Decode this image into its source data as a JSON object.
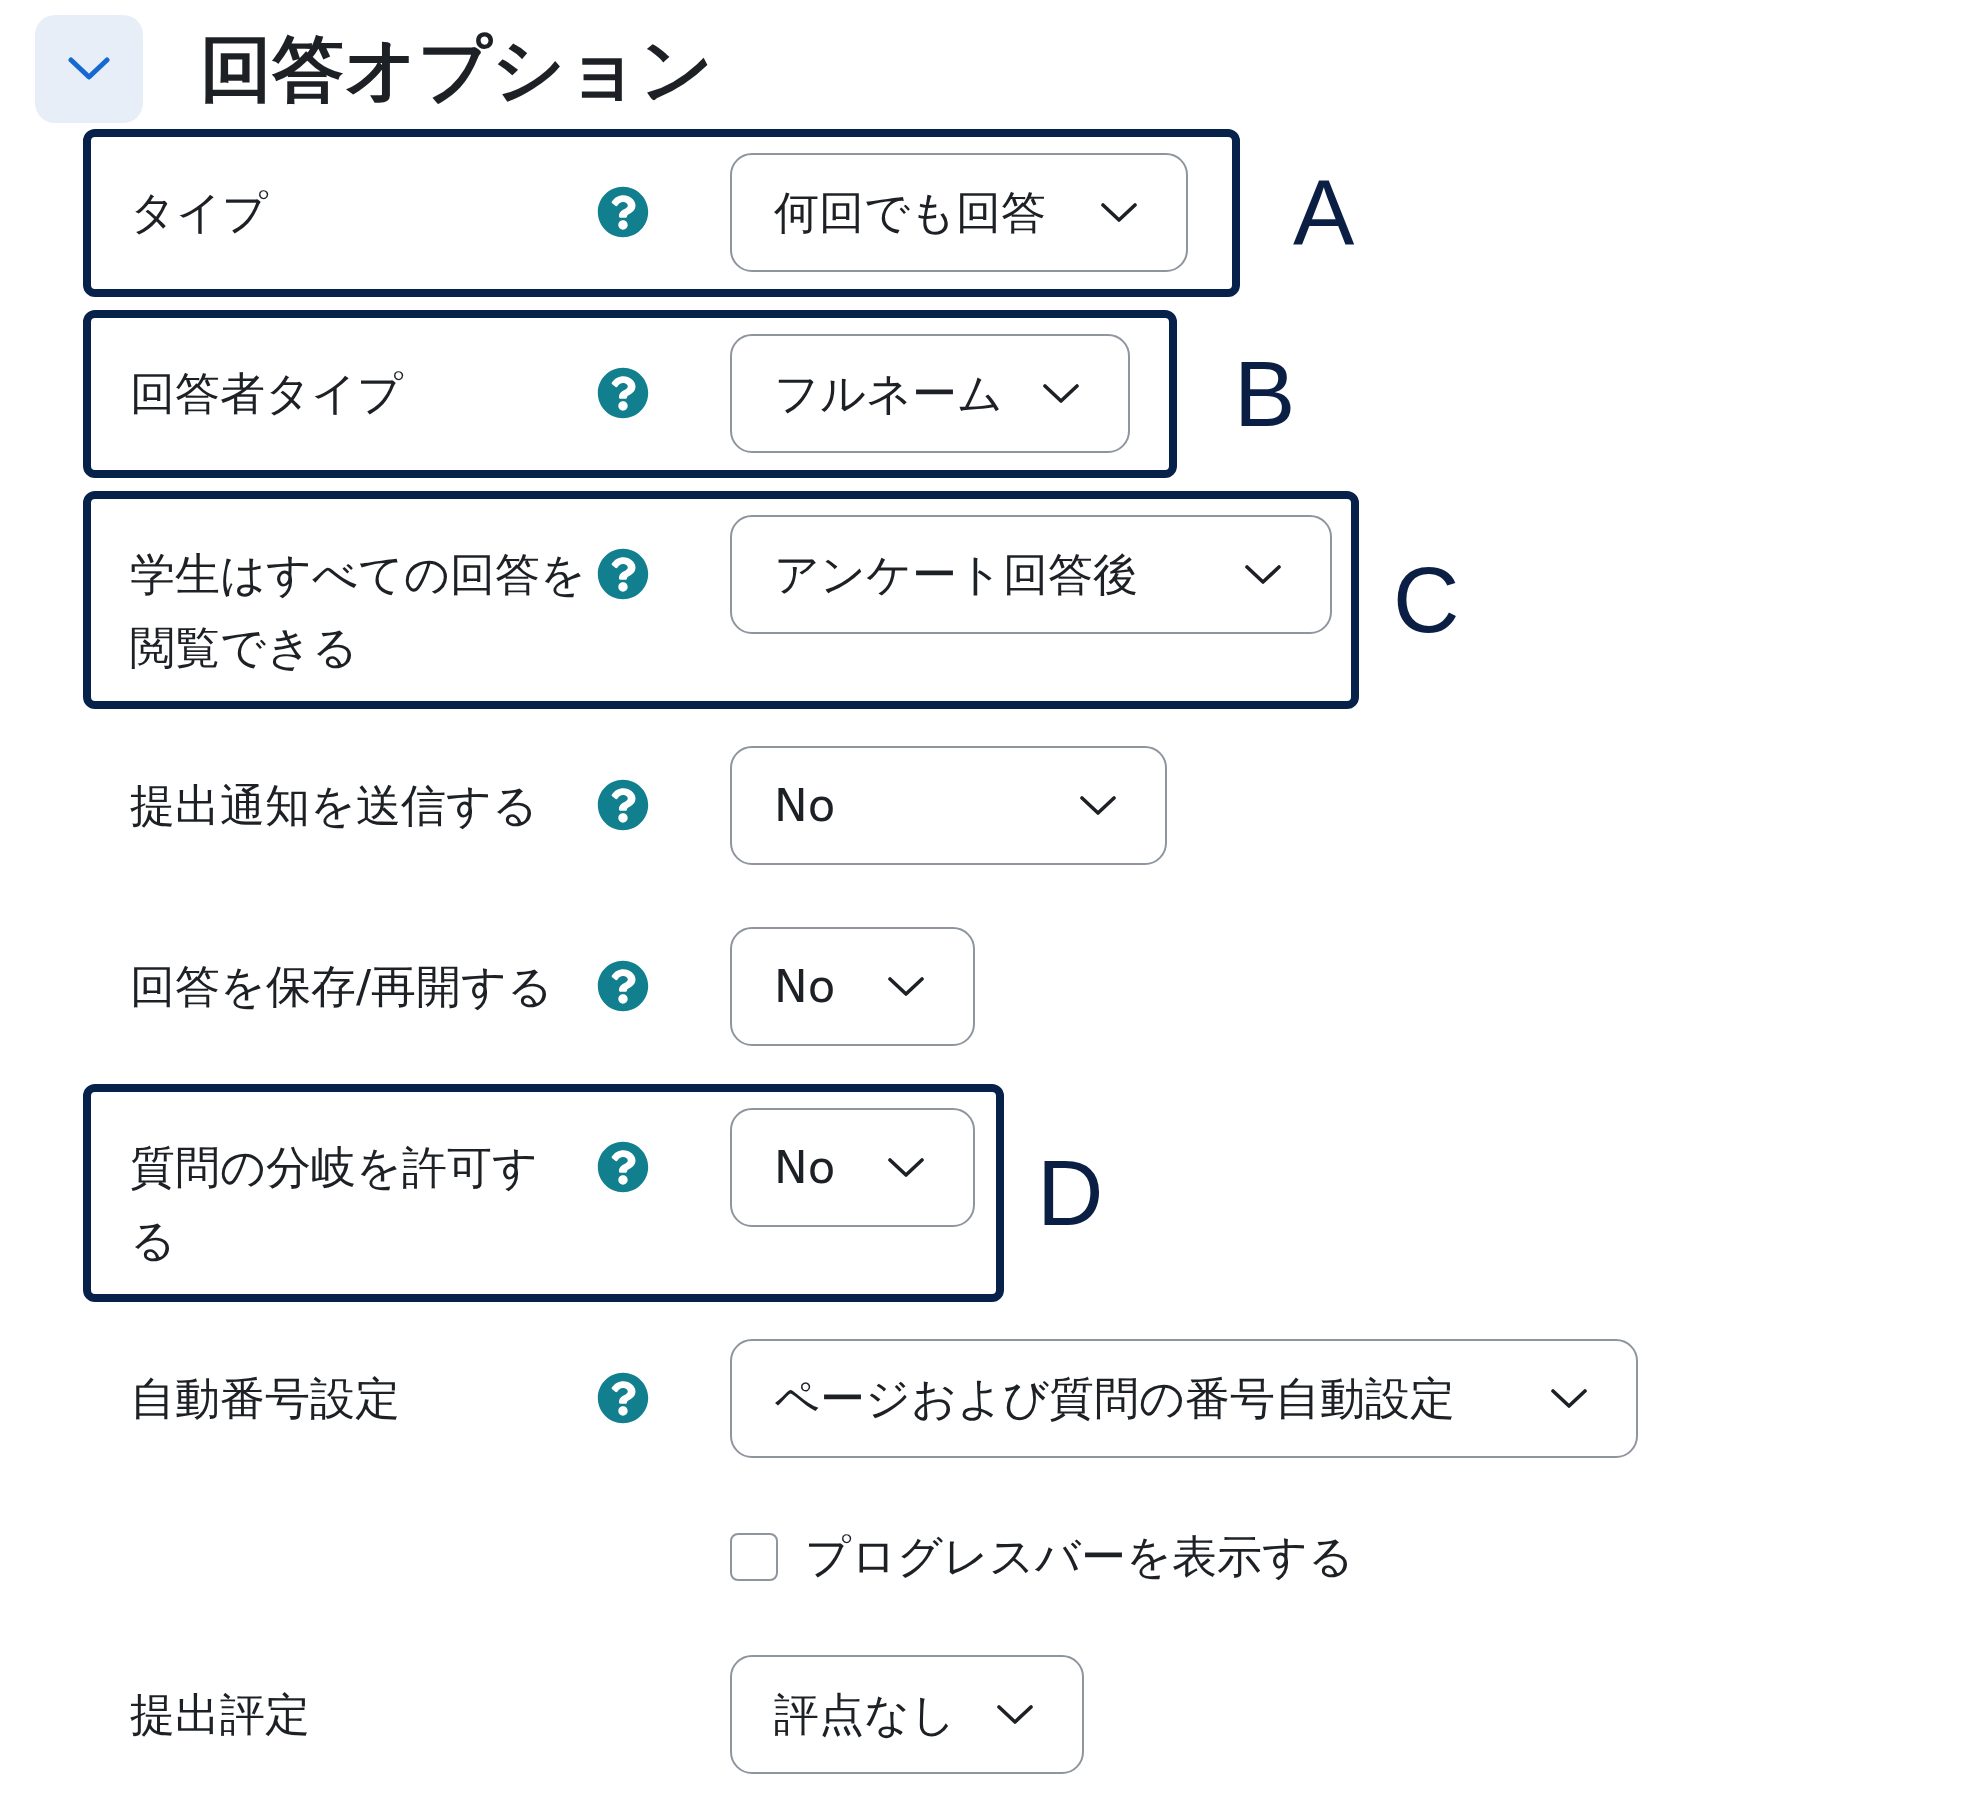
{
  "section": {
    "title": "回答オプション",
    "expanded": true
  },
  "fields": [
    {
      "kind": "select",
      "label": "タイプ",
      "help": true,
      "value": "何回でも回答",
      "callout": "A"
    },
    {
      "kind": "select",
      "label": "回答者タイプ",
      "help": true,
      "value": "フルネーム",
      "callout": "B"
    },
    {
      "kind": "select",
      "label": "学生はすべての回答を閲覧できる",
      "help": true,
      "value": "アンケート回答後",
      "callout": "C"
    },
    {
      "kind": "select",
      "label": "提出通知を送信する",
      "help": true,
      "value": "No"
    },
    {
      "kind": "select",
      "label": "回答を保存/再開する",
      "help": true,
      "value": "No"
    },
    {
      "kind": "select",
      "label": "質問の分岐を許可する",
      "help": true,
      "value": "No",
      "callout": "D"
    },
    {
      "kind": "select",
      "label": "自動番号設定",
      "help": true,
      "value": "ページおよび質問の番号自動設定"
    },
    {
      "kind": "checkbox",
      "label": "プログレスバーを表示する",
      "checked": false
    },
    {
      "kind": "select",
      "label": "提出評定",
      "help": false,
      "value": "評点なし"
    }
  ]
}
